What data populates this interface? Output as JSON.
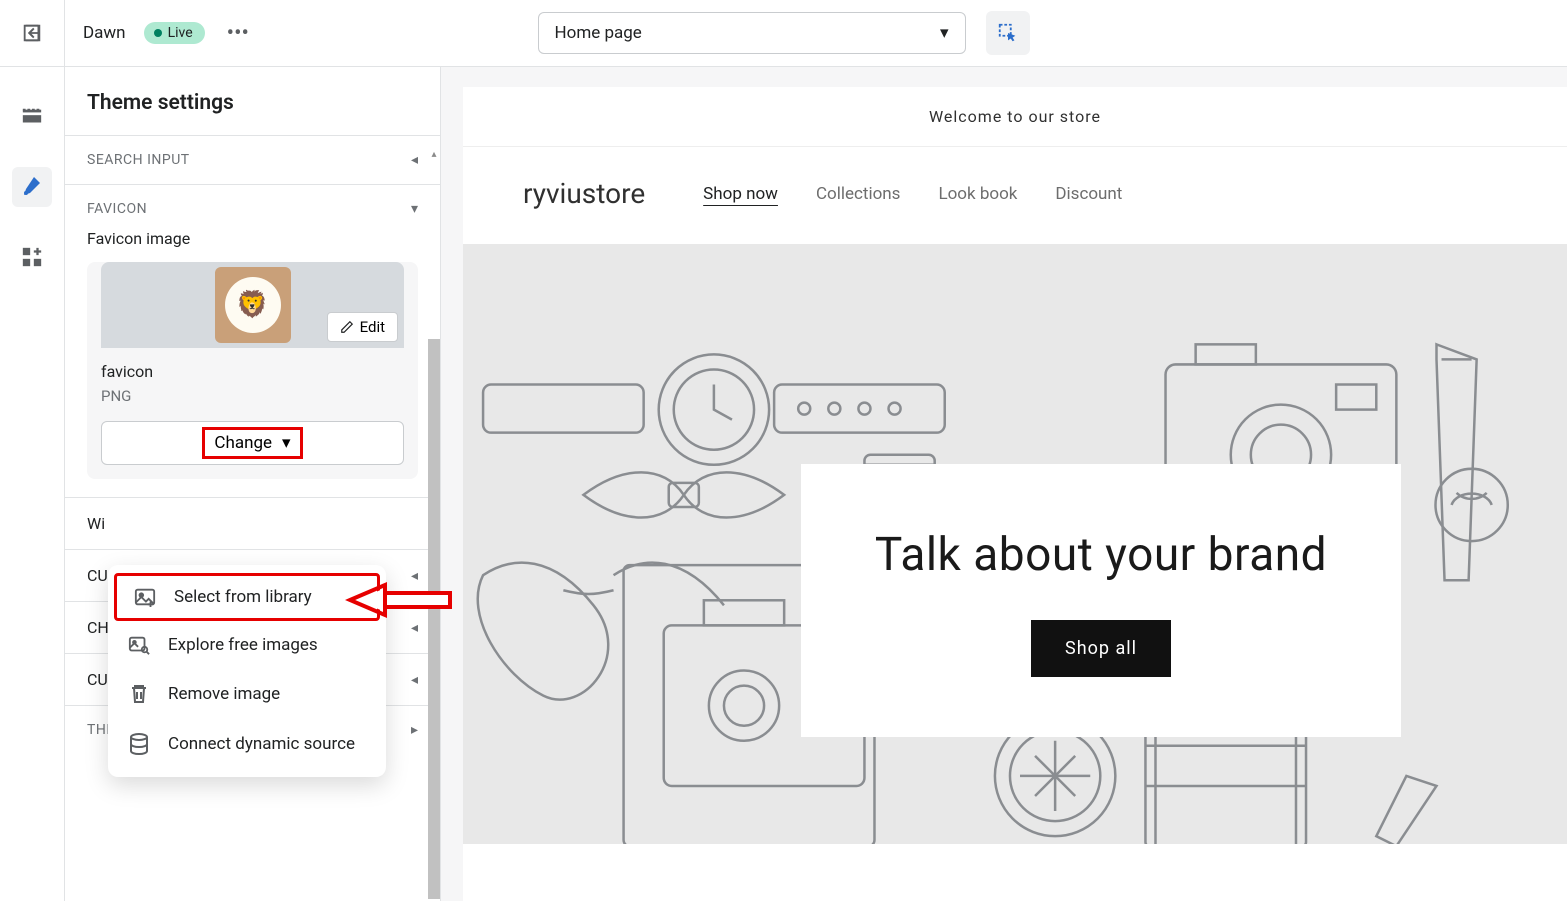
{
  "topbar": {
    "theme_name": "Dawn",
    "live_label": "Live",
    "page_select": "Home page"
  },
  "panel": {
    "title": "Theme settings",
    "sections": {
      "search_input": "SEARCH INPUT",
      "favicon": "FAVICON",
      "favicon_image_label": "Favicon image",
      "favicon_name": "favicon",
      "favicon_type": "PNG",
      "edit_label": "Edit",
      "change_label": "Change",
      "wi_partial": "Wi",
      "cu_partial": "CU",
      "ch_partial": "CH",
      "cu2_partial": "CU",
      "theme_style": "THEME STYLE"
    }
  },
  "dropdown": {
    "select_library": "Select from library",
    "explore_images": "Explore free images",
    "remove_image": "Remove image",
    "connect_dynamic": "Connect dynamic source"
  },
  "preview": {
    "announce": "Welcome to our store",
    "logo": "ryviustore",
    "nav": [
      "Shop now",
      "Collections",
      "Look book",
      "Discount"
    ],
    "hero_title": "Talk about your brand",
    "hero_button": "Shop all"
  }
}
